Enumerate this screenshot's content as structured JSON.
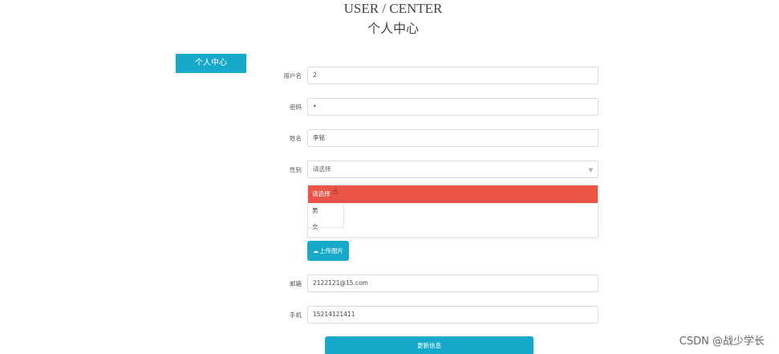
{
  "header": {
    "title_en": "USER / CENTER",
    "title_cn": "个人中心"
  },
  "sidebar": {
    "tab_label": "个人中心"
  },
  "form": {
    "username": {
      "label": "用户名",
      "value": "2"
    },
    "password": {
      "label": "密码",
      "value": "•"
    },
    "name": {
      "label": "姓名",
      "value": "李铭"
    },
    "gender": {
      "label": "性别",
      "placeholder": "请选择",
      "arrow": "▼",
      "options": [
        "请选择",
        "男",
        "女"
      ]
    },
    "upload_label": "上传图片",
    "email": {
      "label": "邮箱",
      "value": "2122121@15.com"
    },
    "phone": {
      "label": "手机",
      "value": "15214121411"
    },
    "submit_label": "更新信息"
  },
  "watermark": "CSDN @战少学长",
  "colors": {
    "accent": "#17a9c9",
    "selected": "#e85445"
  }
}
